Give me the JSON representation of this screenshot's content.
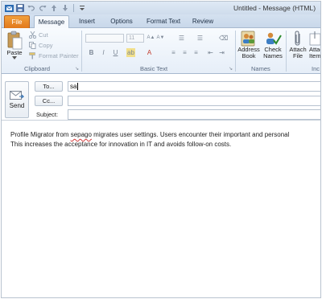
{
  "window": {
    "title": "Untitled - Message (HTML)"
  },
  "tabs": [
    {
      "label": "File"
    },
    {
      "label": "Message"
    },
    {
      "label": "Insert"
    },
    {
      "label": "Options"
    },
    {
      "label": "Format Text"
    },
    {
      "label": "Review"
    }
  ],
  "ribbon": {
    "clipboard": {
      "paste": "Paste",
      "cut": "Cut",
      "copy": "Copy",
      "format_painter": "Format Painter",
      "label": "Clipboard"
    },
    "basic_text": {
      "font_size": "11",
      "bold": "B",
      "italic": "I",
      "underline": "U",
      "label": "Basic Text"
    },
    "names": {
      "address_book": [
        "Address",
        "Book"
      ],
      "check_names": [
        "Check",
        "Names"
      ],
      "label": "Names"
    },
    "include": {
      "attach_file": [
        "Attach",
        "File"
      ],
      "attach_item": [
        "Attach",
        "Item"
      ],
      "label": "Inc"
    }
  },
  "compose": {
    "send": "Send",
    "to_button": "To...",
    "cc_button": "Cc...",
    "subject_label": "Subject:",
    "to_value": "sa",
    "cc_value": "",
    "subject_value": ""
  },
  "body": {
    "line1_pre": "Profile Migrator from ",
    "line1_word": "sepago",
    "line1_post": " migrates user settings. Users encounter their important and personal",
    "line2": "This increases the acceptance for innovation in IT and avoids follow-on costs."
  }
}
